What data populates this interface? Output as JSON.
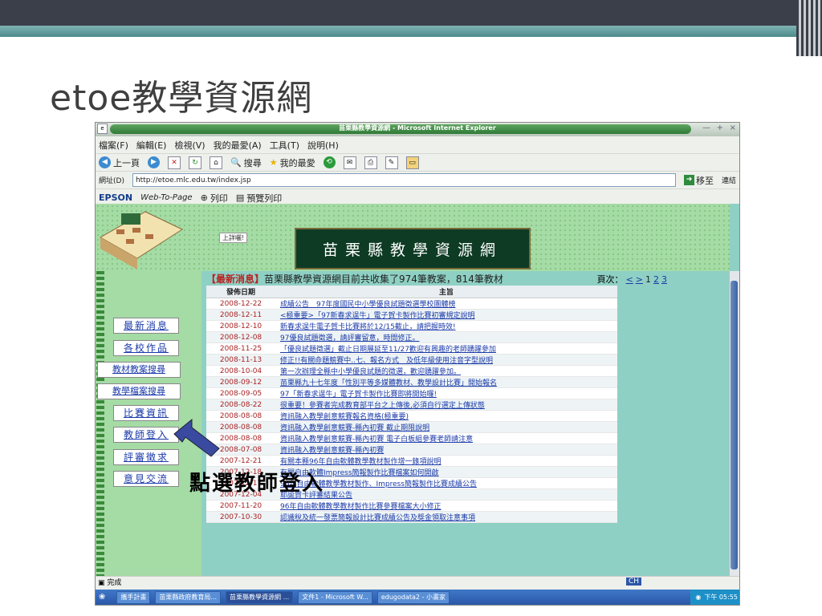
{
  "slide": {
    "title": "etoe教學資源網",
    "callout": "點選教師登入"
  },
  "window": {
    "title": "苗栗縣教學資源網 - Microsoft Internet Explorer",
    "min": "—",
    "max": "+",
    "close": "×"
  },
  "menu": [
    "檔案(F)",
    "編輯(E)",
    "檢視(V)",
    "我的最愛(A)",
    "工具(T)",
    "說明(H)"
  ],
  "toolbar": {
    "back": "上一頁",
    "search": "搜尋",
    "favorites": "我的最愛"
  },
  "address": {
    "label": "網址(D)",
    "url": "http://etoe.mlc.edu.tw/index.jsp",
    "go": "移至",
    "links": "連結"
  },
  "epson": {
    "brand": "EPSON",
    "product": "Web-To-Page",
    "print": "列印",
    "preview": "預覽列印"
  },
  "header": {
    "banner": "苗栗縣教學資源網",
    "small": "上詳曬!"
  },
  "nav": [
    "最新消息",
    "各校作品",
    "教材教案搜尋",
    "教學檔案搜尋",
    "比賽資訊",
    "教師登入",
    "評審徵求",
    "意見交流"
  ],
  "news": {
    "tag": "【最新消息】",
    "summary": "苗栗縣教學資源網目前共收集了974筆教案，814筆教材",
    "pager_label": "頁次：",
    "pages": [
      "<",
      ">",
      "1",
      "2",
      "3"
    ],
    "col_date": "發佈日期",
    "col_subject": "主旨",
    "rows": [
      {
        "date": "2008-12-22",
        "subject": "成績公告　97年度國民中小學優良試題徵選學校團體榜"
      },
      {
        "date": "2008-12-11",
        "subject": "<極重要>「97新春求逞牛」電子賀卡製作比賽初審規定說明"
      },
      {
        "date": "2008-12-10",
        "subject": "新春求逞牛電子賀卡比賽將於12/15截止，請把握時效!"
      },
      {
        "date": "2008-12-08",
        "subject": "97優良試題徵選，請評審留意，時間修正。"
      },
      {
        "date": "2008-11-25",
        "subject": "「優良試題徵選」截止日期展延至11/27歡迎有興趣的老師踴躍參加"
      },
      {
        "date": "2008-11-13",
        "subject": "修正!!有關命題競賽中..七、報名方式　及低年級使用注音字型說明"
      },
      {
        "date": "2008-10-04",
        "subject": "第一次辦理全縣中小學優良試題的徵選，歡迎踴躍參加。"
      },
      {
        "date": "2008-09-12",
        "subject": "苗栗縣九十七年度「性別平等多媒體教材、教學設計比賽」開始報名"
      },
      {
        "date": "2008-09-05",
        "subject": "97「新春求逞牛」電子賀卡製作比賽即將開始囉!"
      },
      {
        "date": "2008-08-22",
        "subject": "很重要！參賽者完成教育部平台之上傳後,必須自行選定上傳狀態"
      },
      {
        "date": "2008-08-08",
        "subject": "資訊融入教學創意競賽報名資格(極重要)"
      },
      {
        "date": "2008-08-08",
        "subject": "資訊融入教學創意競賽-縣內初賽 截止期限說明"
      },
      {
        "date": "2008-08-08",
        "subject": "資訊融入教學創意競賽-縣內初賽 電子白板組參賽老師請注意"
      },
      {
        "date": "2008-07-08",
        "subject": "資訊融入教學創意競賽-縣內初賽"
      },
      {
        "date": "2007-12-21",
        "subject": "有關本縣96年自由軟體教學教材製作增一錄項說明"
      },
      {
        "date": "2007-12-18",
        "subject": "有關自由軟體Impress簡報製作比賽檔案如何開啟"
      },
      {
        "date": "2007-12-17",
        "subject": "96年自由軟體教學教材製作、Impress簡報製作比賽成績公告"
      },
      {
        "date": "2007-12-04",
        "subject": "耶誕賀卡評審結果公告"
      },
      {
        "date": "2007-11-20",
        "subject": "96年自由軟體教學教材製作比賽參賽檔案大小修正"
      },
      {
        "date": "2007-10-30",
        "subject": "認識稅及統一發票簡報設計比賽成績公告及獎金領取注意事項"
      }
    ]
  },
  "status": {
    "text": "完成"
  },
  "taskbar": {
    "items": [
      "攜手計畫",
      "苗栗縣政府教育局...",
      "苗栗縣教學資源網 ...",
      "文件1 - Microsoft W...",
      "edugodata2 - 小畫家"
    ],
    "clock": "下午 05:55",
    "ime": "CH"
  }
}
